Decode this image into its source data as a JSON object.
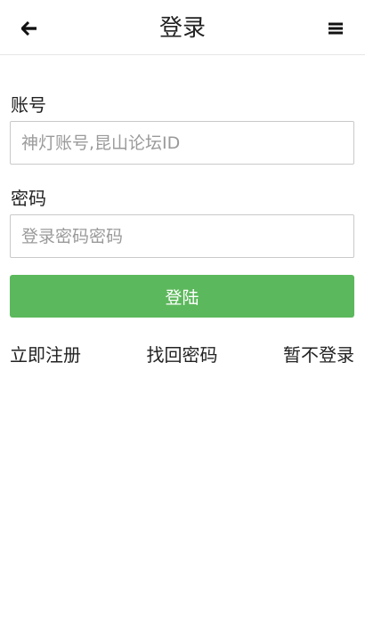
{
  "header": {
    "title": "登录",
    "back_icon": "arrow-left-icon",
    "menu_icon": "hamburger-menu-icon"
  },
  "form": {
    "account": {
      "label": "账号",
      "value": "",
      "placeholder": "神灯账号,昆山论坛ID"
    },
    "password": {
      "label": "密码",
      "value": "",
      "placeholder": "登录密码密码"
    },
    "submit_label": "登陆"
  },
  "links": {
    "register": "立即注册",
    "forgot_password": "找回密码",
    "skip_login": "暂不登录"
  },
  "colors": {
    "primary_button": "#5cb85c",
    "text": "#222222",
    "border": "#c9c9c9"
  }
}
